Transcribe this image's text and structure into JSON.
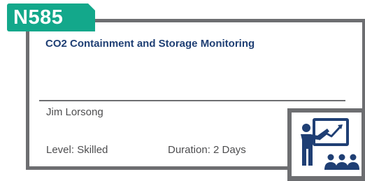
{
  "course": {
    "code": "N585",
    "title": "CO2 Containment and Storage Monitoring",
    "instructor": "Jim Lorsong",
    "level": "Level: Skilled",
    "duration": "Duration: 2 Days"
  },
  "icon": {
    "name": "classroom-presentation-icon",
    "color": "#1f3f74"
  },
  "colors": {
    "accent": "#13a88b",
    "border": "#6d6e71",
    "title": "#1f3f74",
    "text": "#4d4d4f"
  }
}
